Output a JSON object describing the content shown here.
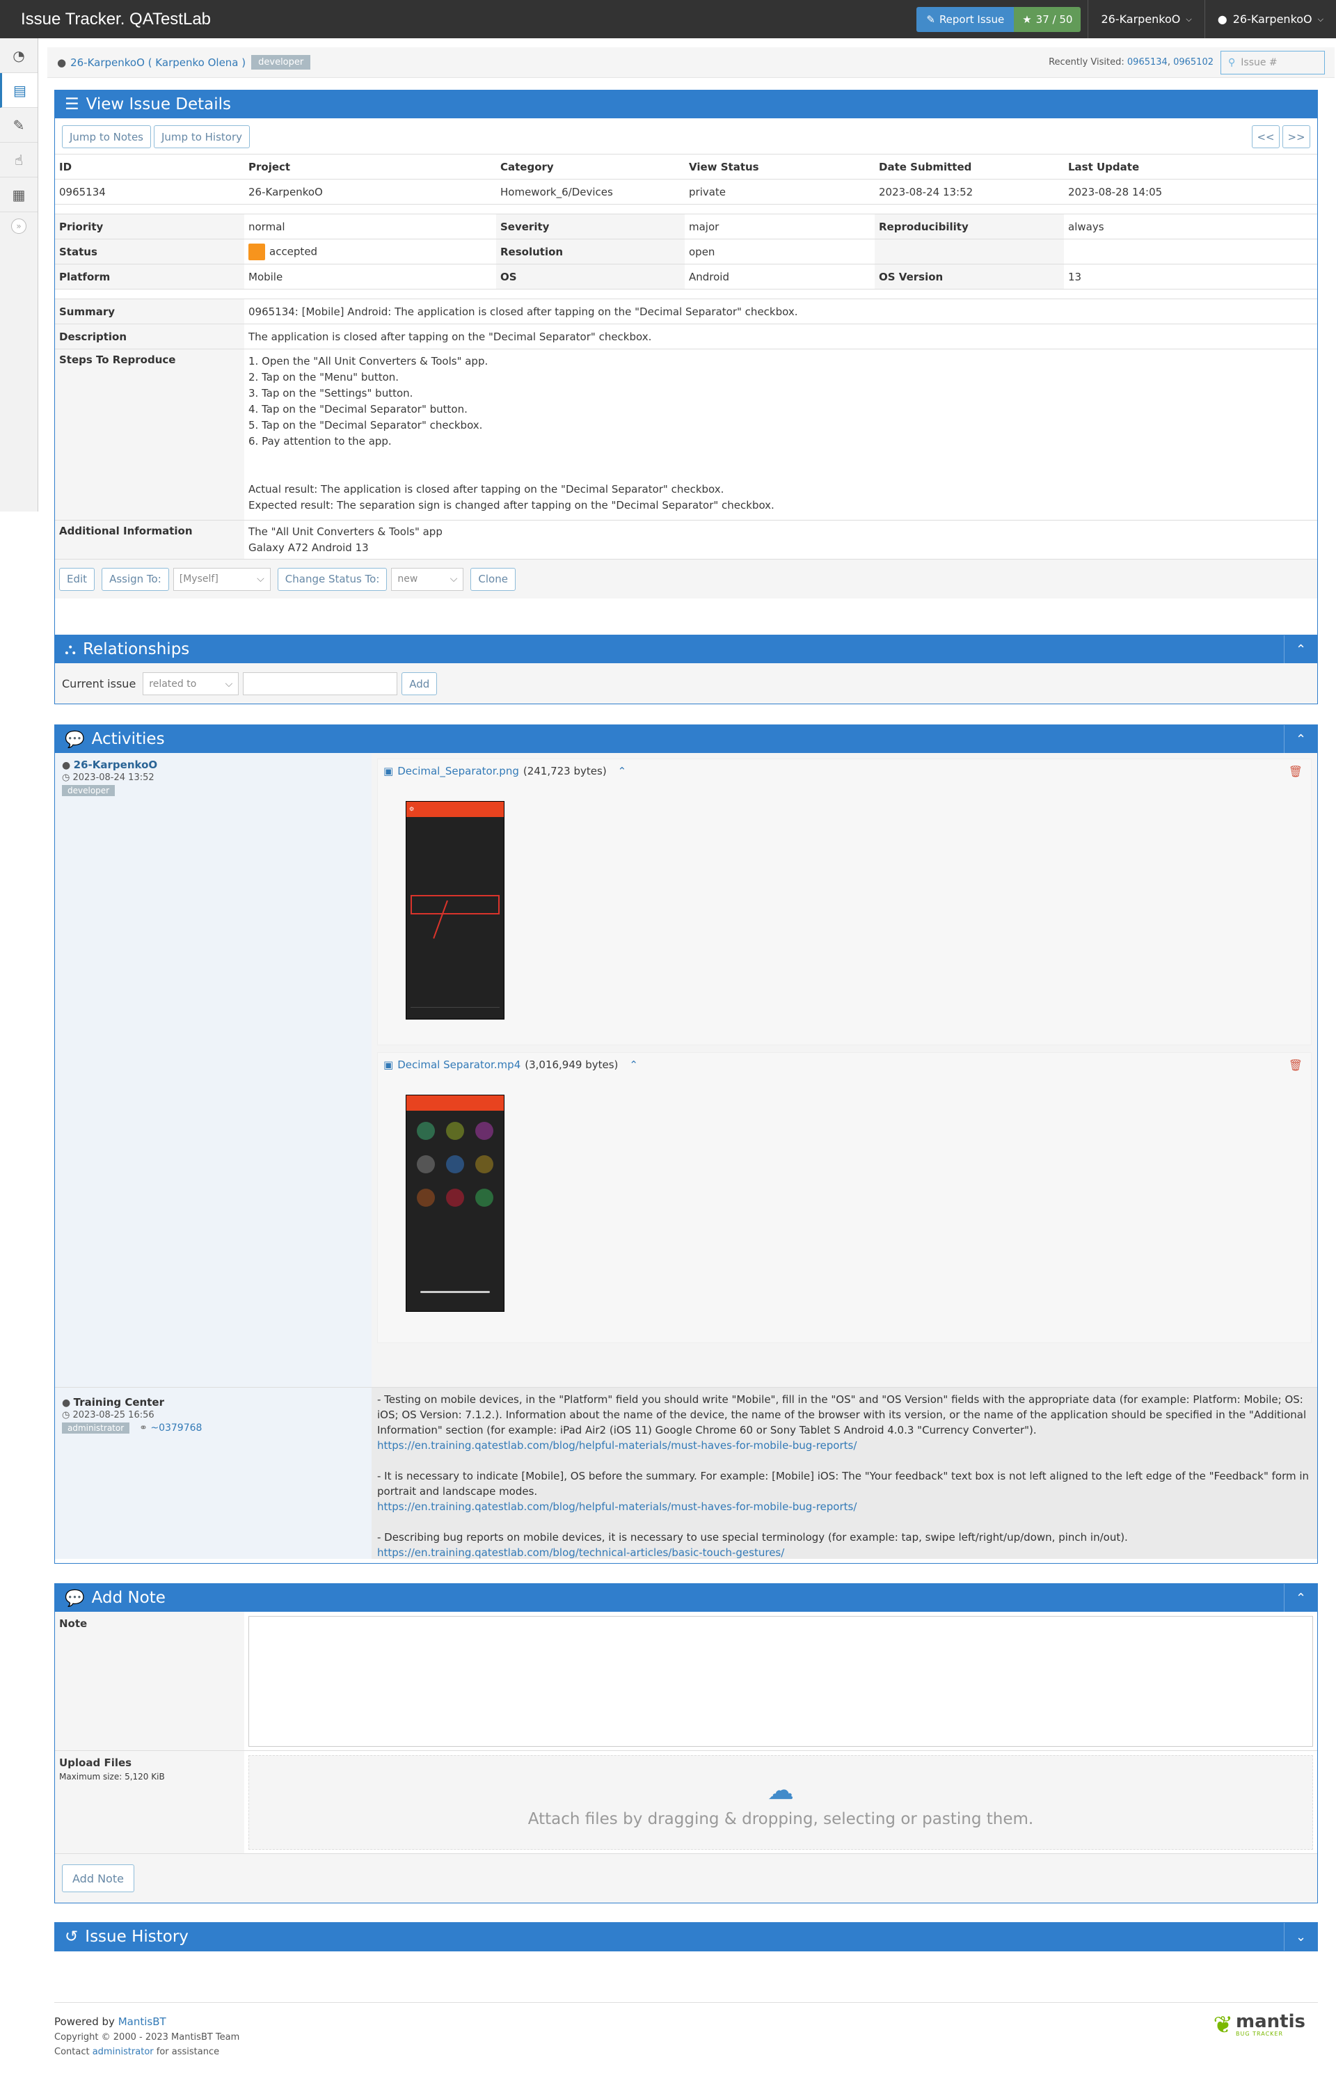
{
  "app": {
    "title": "Issue Tracker. QATestLab"
  },
  "navbar": {
    "report_label": "Report Issue",
    "count_label": "37 / 50",
    "project_dropdown": "26-KarpenkoO",
    "user_dropdown": "26-KarpenkoO"
  },
  "breadcrumb": {
    "user": "26-KarpenkoO ( Karpenko Olena )",
    "role": "developer",
    "recent_label": "Recently Visited:",
    "recent_1": "0965134",
    "recent_sep": ",",
    "recent_2": "0965102",
    "search_placeholder": "Issue #"
  },
  "view_issue": {
    "title": "View Issue Details",
    "jump_notes": "Jump to Notes",
    "jump_history": "Jump to History",
    "prev": "<<",
    "next": ">>",
    "headers": [
      "ID",
      "Project",
      "Category",
      "View Status",
      "Date Submitted",
      "Last Update"
    ],
    "values": [
      "0965134",
      "26-KarpenkoO",
      "Homework_6/Devices",
      "private",
      "2023-08-24 13:52",
      "2023-08-28 14:05"
    ],
    "priority_label": "Priority",
    "priority": "normal",
    "severity_label": "Severity",
    "severity": "major",
    "reproducibility_label": "Reproducibility",
    "reproducibility": "always",
    "status_label": "Status",
    "status": "accepted",
    "resolution_label": "Resolution",
    "resolution": "open",
    "platform_label": "Platform",
    "platform": "Mobile",
    "os_label": "OS",
    "os": "Android",
    "os_version_label": "OS Version",
    "os_version": "13",
    "summary_label": "Summary",
    "summary": "0965134: [Mobile] Android: The application is closed after tapping on the \"Decimal Separator\" checkbox.",
    "description_label": "Description",
    "description": "The application is closed after tapping on the \"Decimal Separator\" checkbox.",
    "steps_label": "Steps To Reproduce",
    "steps": [
      "1. Open the \"All Unit Converters & Tools\" app.",
      "2. Tap on the \"Menu\" button.",
      "3. Tap on the \"Settings\" button.",
      "4. Tap on the \"Decimal Separator\" button.",
      "5. Tap on the \"Decimal Separator\" checkbox.",
      "6. Pay attention to the app."
    ],
    "actual": "Actual result: The application is closed after tapping on the \"Decimal Separator\" checkbox.",
    "expected": "Expected result: The separation sign is changed after tapping on the \"Decimal Separator\" checkbox.",
    "additional_label": "Additional Information",
    "additional_1": "The \"All Unit Converters & Tools\" app",
    "additional_2": "Galaxy A72 Android 13",
    "edit": "Edit",
    "assign_to": "Assign To:",
    "assign_value": "[Myself]",
    "change_status": "Change Status To:",
    "status_value": "new",
    "clone": "Clone"
  },
  "relationships": {
    "title": "Relationships",
    "current_issue": "Current issue",
    "relation_value": "related to",
    "add": "Add"
  },
  "activities": {
    "title": "Activities",
    "entry1": {
      "author": "26-KarpenkoO",
      "date": "2023-08-24 13:52",
      "role": "developer",
      "file1_name": "Decimal_Separator.png",
      "file1_size": "(241,723 bytes)",
      "file2_name": "Decimal Separator.mp4",
      "file2_size": "(3,016,949 bytes)"
    },
    "entry2": {
      "author": "Training Center",
      "date": "2023-08-25 16:56",
      "role": "administrator",
      "note_id": "~0379768",
      "p1": "- Testing on mobile devices, in the \"Platform\" field you should write \"Mobile\", fill in the \"OS\" and \"OS Version\" fields with the appropriate data (for example: Platform: Mobile; OS: iOS; OS Version: 7.1.2.). Information about the name of the device, the name of the browser with its version, or the name of the application should be specified in the \"Additional Information\" section (for example: iPad Air2 (iOS 11) Google Chrome 60 or Sony Tablet S Android 4.0.3 \"Currency Converter\").",
      "link1": "https://en.training.qatestlab.com/blog/helpful-materials/must-haves-for-mobile-bug-reports/",
      "p2": "- It is necessary to indicate [Mobile], OS before the summary. For example: [Mobile] iOS: The \"Your feedback\" text box is not left aligned to the left edge of the \"Feedback\" form in portrait and landscape modes.",
      "link2": "https://en.training.qatestlab.com/blog/helpful-materials/must-haves-for-mobile-bug-reports/",
      "p3": "- Describing bug reports on mobile devices, it is necessary to use special terminology (for example: tap, swipe left/right/up/down, pinch in/out).",
      "link3": "https://en.training.qatestlab.com/blog/technical-articles/basic-touch-gestures/"
    }
  },
  "add_note": {
    "title": "Add Note",
    "note_label": "Note",
    "upload_label": "Upload Files",
    "max_size": "Maximum size: 5,120 KiB",
    "drop_text": "Attach files by dragging & dropping, selecting or pasting them.",
    "submit": "Add Note"
  },
  "history": {
    "title": "Issue History"
  },
  "footer": {
    "powered": "Powered by",
    "mantis": "MantisBT",
    "copyright": "Copyright © 2000 - 2023 MantisBT Team",
    "contact_prefix": "Contact",
    "contact_link": "administrator",
    "contact_suffix": "for assistance",
    "logo_text": "mantis",
    "logo_sub": "BUG TRACKER"
  },
  "colors": {
    "accent": "#307ecc",
    "status_accepted": "#f7941d",
    "navbar": "#333333"
  }
}
